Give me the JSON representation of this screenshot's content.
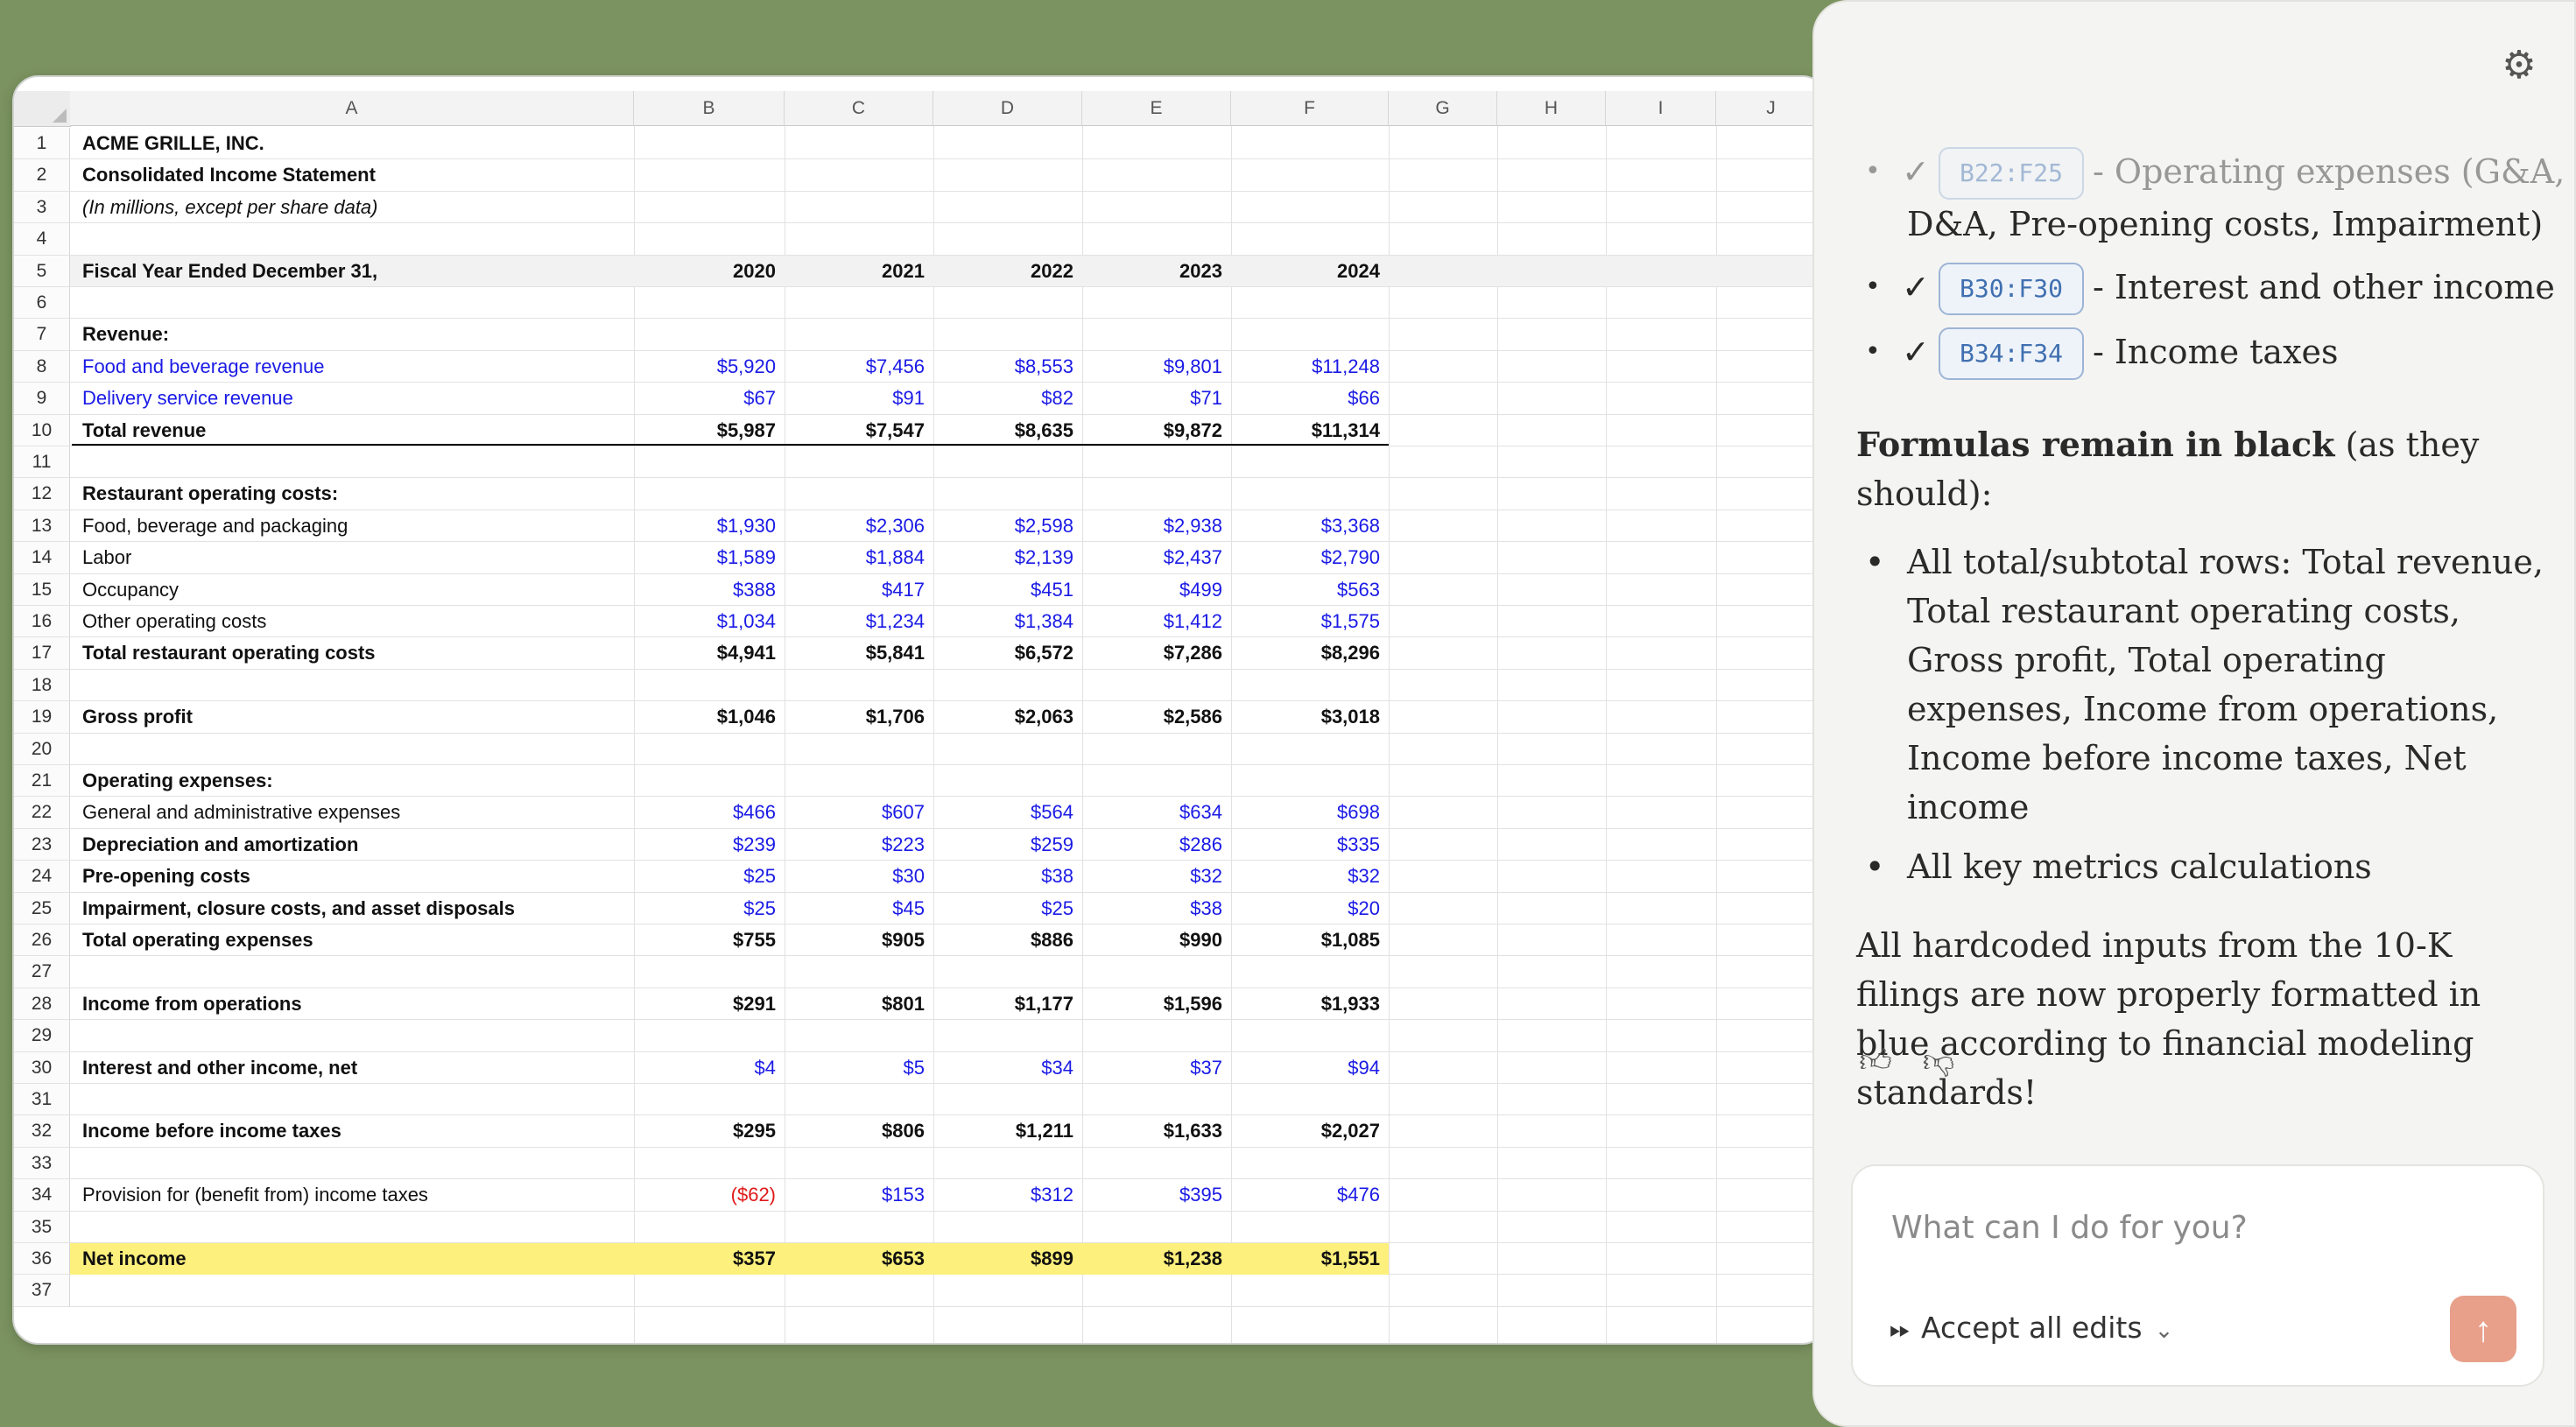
{
  "sheet": {
    "columns": [
      "A",
      "B",
      "C",
      "D",
      "E",
      "F",
      "G",
      "H",
      "I",
      "J"
    ],
    "rows": [
      {
        "n": "1",
        "label": "ACME GRILLE, INC.",
        "style": "bold",
        "values": []
      },
      {
        "n": "2",
        "label": "Consolidated Income Statement",
        "style": "bold",
        "values": []
      },
      {
        "n": "3",
        "label": "(In millions, except per share data)",
        "style": "italic",
        "values": []
      },
      {
        "n": "4",
        "label": "",
        "values": []
      },
      {
        "n": "5",
        "label": "Fiscal Year Ended December 31,",
        "style": "bold",
        "shaded": true,
        "values": [
          "2020",
          "2021",
          "2022",
          "2023",
          "2024"
        ],
        "vstyle": "bold"
      },
      {
        "n": "6",
        "label": "",
        "values": []
      },
      {
        "n": "7",
        "label": "Revenue:",
        "style": "bold",
        "values": []
      },
      {
        "n": "8",
        "label": "Food and beverage revenue",
        "style": "blue",
        "values": [
          "$5,920",
          "$7,456",
          "$8,553",
          "$9,801",
          "$11,248"
        ],
        "vstyle": "blue"
      },
      {
        "n": "9",
        "label": "Delivery service revenue",
        "style": "blue",
        "values": [
          "$67",
          "$91",
          "$82",
          "$71",
          "$66"
        ],
        "vstyle": "blue"
      },
      {
        "n": "10",
        "label": "Total revenue",
        "style": "bold",
        "values": [
          "$5,987",
          "$7,547",
          "$8,635",
          "$9,872",
          "$11,314"
        ],
        "vstyle": "bold",
        "bottomline": true
      },
      {
        "n": "11",
        "label": "",
        "values": []
      },
      {
        "n": "12",
        "label": "Restaurant operating costs:",
        "style": "bold",
        "values": []
      },
      {
        "n": "13",
        "label": "Food, beverage and packaging",
        "values": [
          "$1,930",
          "$2,306",
          "$2,598",
          "$2,938",
          "$3,368"
        ],
        "vstyle": "blue"
      },
      {
        "n": "14",
        "label": "Labor",
        "values": [
          "$1,589",
          "$1,884",
          "$2,139",
          "$2,437",
          "$2,790"
        ],
        "vstyle": "blue"
      },
      {
        "n": "15",
        "label": "Occupancy",
        "values": [
          "$388",
          "$417",
          "$451",
          "$499",
          "$563"
        ],
        "vstyle": "blue"
      },
      {
        "n": "16",
        "label": "Other operating costs",
        "values": [
          "$1,034",
          "$1,234",
          "$1,384",
          "$1,412",
          "$1,575"
        ],
        "vstyle": "blue"
      },
      {
        "n": "17",
        "label": "Total restaurant operating costs",
        "style": "bold",
        "values": [
          "$4,941",
          "$5,841",
          "$6,572",
          "$7,286",
          "$8,296"
        ],
        "vstyle": "bold"
      },
      {
        "n": "18",
        "label": "",
        "values": []
      },
      {
        "n": "19",
        "label": "Gross profit",
        "style": "bold",
        "values": [
          "$1,046",
          "$1,706",
          "$2,063",
          "$2,586",
          "$3,018"
        ],
        "vstyle": "bold"
      },
      {
        "n": "20",
        "label": "",
        "values": []
      },
      {
        "n": "21",
        "label": "Operating expenses:",
        "style": "bold",
        "values": []
      },
      {
        "n": "22",
        "label": "General and administrative expenses",
        "values": [
          "$466",
          "$607",
          "$564",
          "$634",
          "$698"
        ],
        "vstyle": "blue"
      },
      {
        "n": "23",
        "label": "Depreciation and amortization",
        "style": "bold",
        "values": [
          "$239",
          "$223",
          "$259",
          "$286",
          "$335"
        ],
        "vstyle": "blue"
      },
      {
        "n": "24",
        "label": "Pre-opening costs",
        "style": "bold",
        "values": [
          "$25",
          "$30",
          "$38",
          "$32",
          "$32"
        ],
        "vstyle": "blue"
      },
      {
        "n": "25",
        "label": "Impairment, closure costs, and asset disposals",
        "style": "bold",
        "values": [
          "$25",
          "$45",
          "$25",
          "$38",
          "$20"
        ],
        "vstyle": "blue"
      },
      {
        "n": "26",
        "label": "Total operating expenses",
        "style": "bold",
        "values": [
          "$755",
          "$905",
          "$886",
          "$990",
          "$1,085"
        ],
        "vstyle": "bold"
      },
      {
        "n": "27",
        "label": "",
        "values": []
      },
      {
        "n": "28",
        "label": "Income from operations",
        "style": "bold",
        "values": [
          "$291",
          "$801",
          "$1,177",
          "$1,596",
          "$1,933"
        ],
        "vstyle": "bold"
      },
      {
        "n": "29",
        "label": "",
        "values": []
      },
      {
        "n": "30",
        "label": "Interest and other income, net",
        "style": "bold",
        "values": [
          "$4",
          "$5",
          "$34",
          "$37",
          "$94"
        ],
        "vstyle": "blue"
      },
      {
        "n": "31",
        "label": "",
        "values": []
      },
      {
        "n": "32",
        "label": "Income before income taxes",
        "style": "bold",
        "values": [
          "$295",
          "$806",
          "$1,211",
          "$1,633",
          "$2,027"
        ],
        "vstyle": "bold"
      },
      {
        "n": "33",
        "label": "",
        "values": []
      },
      {
        "n": "34",
        "label": "Provision for (benefit from) income taxes",
        "values": [
          "($62)",
          "$153",
          "$312",
          "$395",
          "$476"
        ],
        "vstyle": "blue",
        "first_red": true
      },
      {
        "n": "35",
        "label": "",
        "values": []
      },
      {
        "n": "36",
        "label": "Net income",
        "style": "bold",
        "highlight": true,
        "values": [
          "$357",
          "$653",
          "$899",
          "$1,238",
          "$1,551"
        ],
        "vstyle": "bold"
      },
      {
        "n": "37",
        "label": "",
        "values": []
      }
    ]
  },
  "chat": {
    "bullets": [
      {
        "check": "✓",
        "range": "B22:F25",
        "desc": "- Operating expenses (G&A,",
        "faded": true,
        "continuation": "D&A, Pre-opening costs, Impairment)"
      },
      {
        "check": "✓",
        "range": "B30:F30",
        "desc": "- Interest and other income"
      },
      {
        "check": "✓",
        "range": "B34:F34",
        "desc": "- Income taxes"
      }
    ],
    "formulas_bold": "Formulas remain in black",
    "formulas_rest": " (as they should):",
    "formula_items": [
      "All total/subtotal rows: Total revenue, Total restaurant operating costs, Gross profit, Total operating expenses, Income from operations, Income before income taxes, Net income",
      "All key metrics calculations"
    ],
    "closing": "All hardcoded inputs from the 10-K filings are now properly formatted in blue according to financial modeling standards!",
    "composer_placeholder": "What can I do for you?",
    "accept_label": "Accept all edits",
    "icons": {
      "settings": "gear-icon",
      "thumb_up": "thumbs-up-icon",
      "thumb_down": "thumbs-down-icon",
      "send": "arrow-up-icon",
      "accept": "fast-forward-icon",
      "chevron": "chevron-down-icon"
    }
  }
}
